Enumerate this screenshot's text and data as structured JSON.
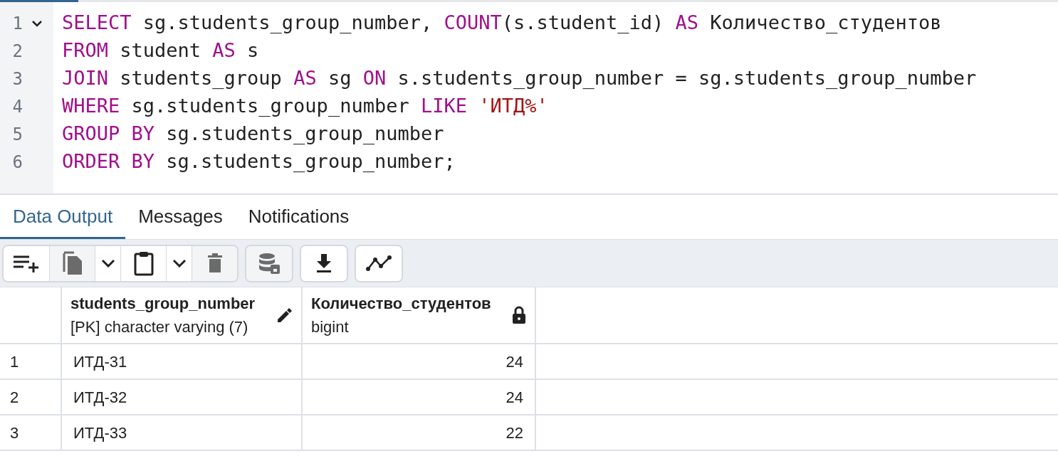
{
  "editor": {
    "lines": [
      {
        "number": "1",
        "fold": {
          "expanded": true
        },
        "tokens": [
          {
            "kind": "keyword",
            "text": "SELECT"
          },
          {
            "kind": "plain",
            "text": " sg.students_group_number, "
          },
          {
            "kind": "keyword",
            "text": "COUNT"
          },
          {
            "kind": "plain",
            "text": "(s.student_id) "
          },
          {
            "kind": "keyword",
            "text": "AS"
          },
          {
            "kind": "plain",
            "text": " Количество_студентов"
          }
        ]
      },
      {
        "number": "2",
        "tokens": [
          {
            "kind": "keyword",
            "text": "FROM"
          },
          {
            "kind": "plain",
            "text": " student "
          },
          {
            "kind": "keyword",
            "text": "AS"
          },
          {
            "kind": "plain",
            "text": " s"
          }
        ]
      },
      {
        "number": "3",
        "tokens": [
          {
            "kind": "keyword",
            "text": "JOIN"
          },
          {
            "kind": "plain",
            "text": " students_group "
          },
          {
            "kind": "keyword",
            "text": "AS"
          },
          {
            "kind": "plain",
            "text": " sg "
          },
          {
            "kind": "keyword",
            "text": "ON"
          },
          {
            "kind": "plain",
            "text": " s.students_group_number = sg.students_group_number"
          }
        ]
      },
      {
        "number": "4",
        "tokens": [
          {
            "kind": "keyword",
            "text": "WHERE"
          },
          {
            "kind": "plain",
            "text": " sg.students_group_number "
          },
          {
            "kind": "keyword",
            "text": "LIKE"
          },
          {
            "kind": "string",
            "text": " 'ИТД%'"
          }
        ]
      },
      {
        "number": "5",
        "tokens": [
          {
            "kind": "keyword",
            "text": "GROUP BY"
          },
          {
            "kind": "plain",
            "text": " sg.students_group_number"
          }
        ]
      },
      {
        "number": "6",
        "tokens": [
          {
            "kind": "keyword",
            "text": "ORDER BY"
          },
          {
            "kind": "plain",
            "text": " sg.students_group_number;"
          }
        ]
      }
    ]
  },
  "tabs": [
    {
      "label": "Data Output",
      "selected": true
    },
    {
      "label": "Messages",
      "selected": false
    },
    {
      "label": "Notifications",
      "selected": false
    }
  ],
  "toolbar": [
    {
      "group": [
        {
          "kind": "add-row",
          "disabled": false
        },
        {
          "kind": "copy",
          "disabled": true
        },
        {
          "kind": "dropdown",
          "disabled": false
        },
        {
          "kind": "paste",
          "disabled": false
        },
        {
          "kind": "dropdown",
          "disabled": false
        },
        {
          "kind": "delete",
          "disabled": true
        }
      ]
    },
    {
      "group": [
        {
          "kind": "save-data",
          "disabled": true
        }
      ]
    },
    {
      "group": [
        {
          "kind": "download",
          "disabled": false
        }
      ]
    },
    {
      "group": [
        {
          "kind": "graph",
          "disabled": false
        }
      ]
    }
  ],
  "table": {
    "columns": [
      {
        "name": "students_group_number",
        "type": "[PK] character varying (7)",
        "kind": "editable"
      },
      {
        "name": "Количество_студентов",
        "type": "bigint",
        "kind": "locked"
      }
    ],
    "rows": [
      {
        "number": "1",
        "cells": [
          "ИТД-31",
          "24"
        ]
      },
      {
        "number": "2",
        "cells": [
          "ИТД-32",
          "24"
        ]
      },
      {
        "number": "3",
        "cells": [
          "ИТД-33",
          "22"
        ]
      }
    ]
  }
}
